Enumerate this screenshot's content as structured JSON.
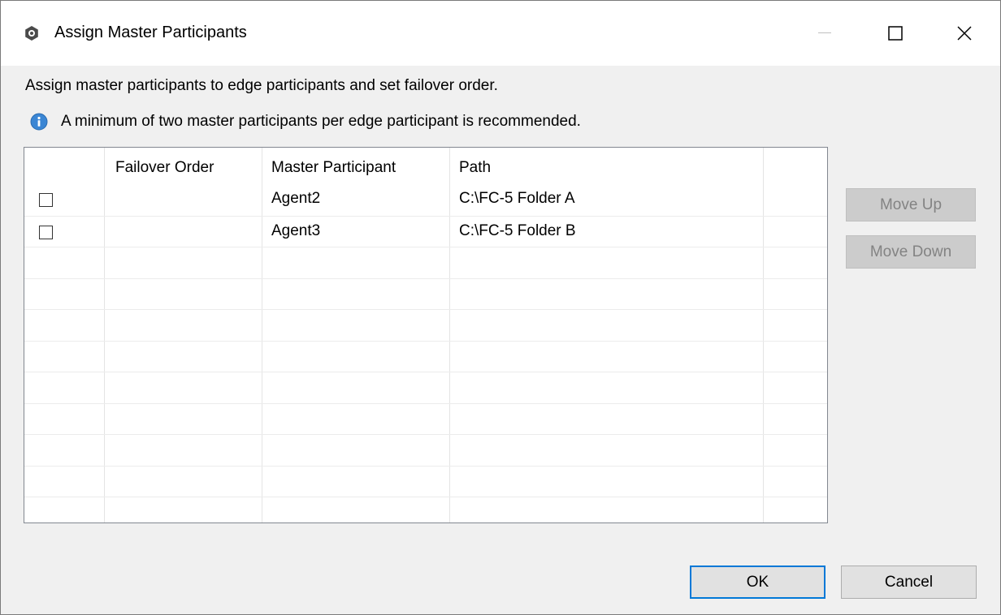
{
  "window": {
    "title": "Assign Master Participants",
    "icons": {
      "app": "gear-app-icon",
      "minimize": "minimize-icon",
      "maximize": "maximize-icon",
      "close": "close-icon"
    }
  },
  "description": "Assign master participants to edge participants and set failover order.",
  "info": {
    "icon": "info-icon",
    "text": "A minimum of two master participants per edge participant is recommended.",
    "color": "#1a73c8"
  },
  "table": {
    "columns": [
      "",
      "Failover Order",
      "Master Participant",
      "Path"
    ],
    "rows": [
      {
        "checked": false,
        "failover_order": "",
        "master_participant": "Agent2",
        "path": "C:\\FC-5 Folder A"
      },
      {
        "checked": false,
        "failover_order": "",
        "master_participant": "Agent3",
        "path": "C:\\FC-5 Folder B"
      }
    ]
  },
  "side_buttons": {
    "move_up": "Move Up",
    "move_down": "Move Down"
  },
  "footer": {
    "ok": "OK",
    "cancel": "Cancel"
  },
  "colors": {
    "accent": "#0078d7",
    "disabled_bg": "#cccccc",
    "disabled_text": "#838383"
  }
}
